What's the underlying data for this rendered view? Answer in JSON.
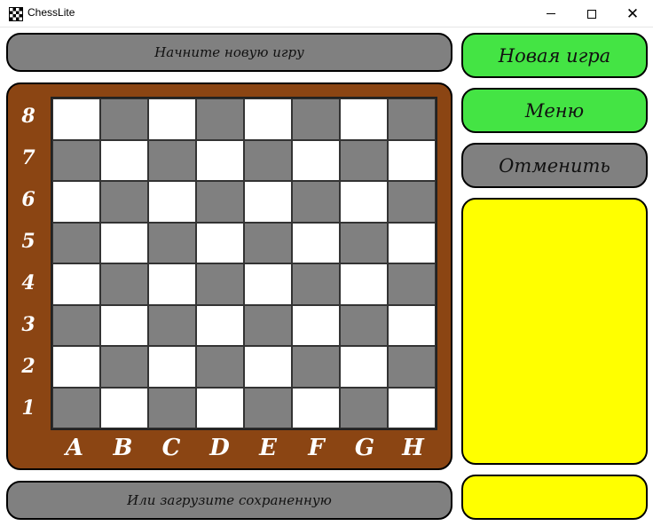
{
  "window": {
    "title": "ChessLite",
    "minimize_glyph": "",
    "maximize_glyph": "",
    "close_glyph": "✕"
  },
  "status": {
    "top": "Начните новую игру",
    "bottom": "Или загрузите сохраненную"
  },
  "buttons": {
    "new_game": "Новая игра",
    "menu": "Меню",
    "undo": "Отменить"
  },
  "board": {
    "ranks": [
      "8",
      "7",
      "6",
      "5",
      "4",
      "3",
      "2",
      "1"
    ],
    "files": [
      "A",
      "B",
      "C",
      "D",
      "E",
      "F",
      "G",
      "H"
    ],
    "light_color": "#ffffff",
    "dark_color": "#808080",
    "frame_color": "#8b4513"
  },
  "colors": {
    "green_button": "#44e444",
    "gray_button": "#808080",
    "panel_yellow": "#ffff00"
  }
}
